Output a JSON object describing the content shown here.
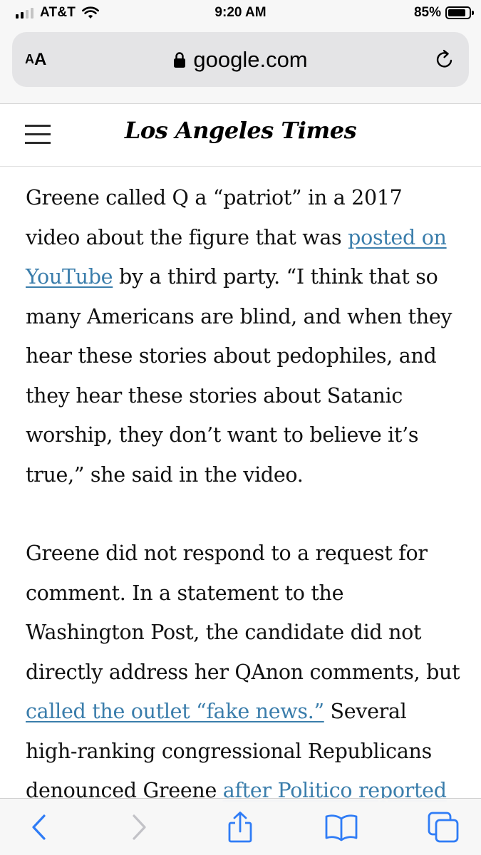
{
  "status_bar": {
    "carrier": "AT&T",
    "time": "9:20 AM",
    "battery_percent": "85%",
    "battery_level": 0.85,
    "signal_bars": 2
  },
  "address_bar": {
    "text_size_label_small": "A",
    "text_size_label_big": "A",
    "url": "google.com"
  },
  "site": {
    "masthead": "Los Angeles Times"
  },
  "article": {
    "p1": {
      "text_1": "Greene called Q a “patriot” in a 2017 video about the figure that was ",
      "link_1": "posted on YouTube",
      "text_2": " by a third party. “I think that so many Americans are blind, and when they hear these stories about pedophiles, and they hear these stories about Satanic worship, they don’t want to believe it’s true,” she said in the video."
    },
    "p2": {
      "text_1": "Greene did not respond to a request for comment. In a statement to the Washington Post, the candidate did not directly address her QAnon comments, but ",
      "link_1": "called the outlet “fake news.”",
      "text_2": " Several high-ranking congressional Republicans denounced Greene ",
      "link_2": "after Politico reported"
    }
  },
  "toolbar": {
    "icons": [
      "back-icon",
      "forward-icon",
      "share-icon",
      "bookmarks-icon",
      "tabs-icon"
    ]
  },
  "colors": {
    "link": "#3a7dab",
    "ios_blue": "#2f7cf6",
    "ios_disabled": "#c2c2c7",
    "chrome_bg": "#f7f7f7",
    "url_field_bg": "#e4e4e6"
  }
}
